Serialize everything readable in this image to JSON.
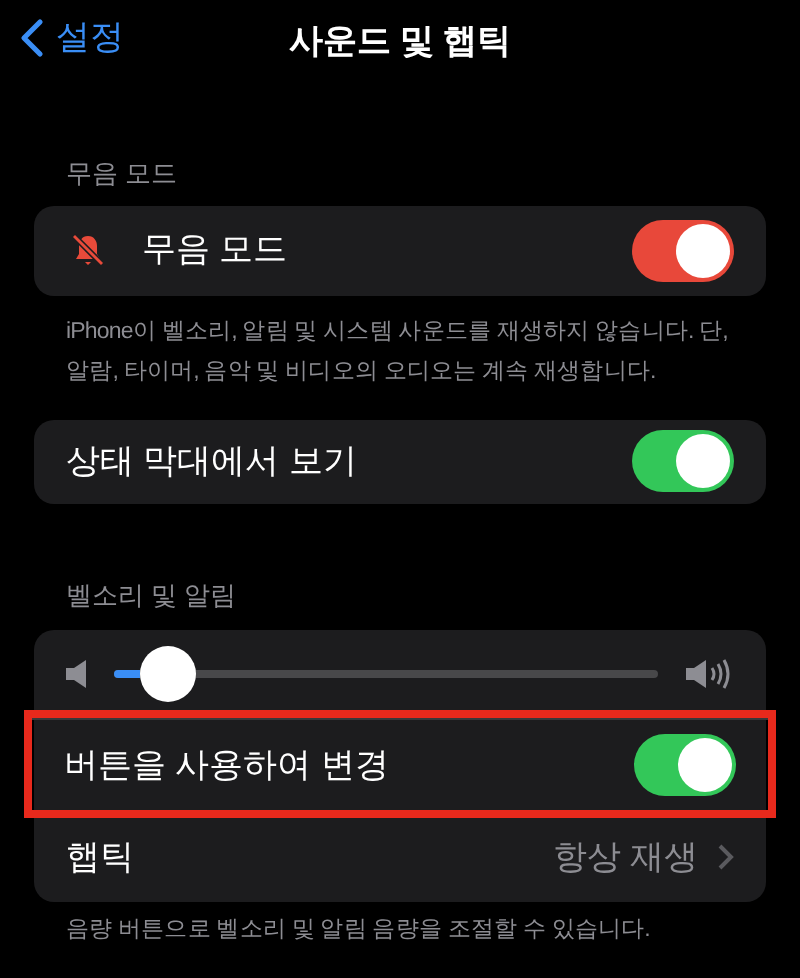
{
  "nav": {
    "back": "설정",
    "title": "사운드 및 햅틱"
  },
  "silent_section": {
    "header": "무음 모드",
    "row": {
      "label": "무음 모드",
      "on": true
    },
    "footer": "iPhone이 벨소리, 알림 및 시스템 사운드를 재생하지 않습니다. 단, 알람, 타이머, 음악 및 비디오의 오디오는 계속 재생합니다."
  },
  "status_bar_row": {
    "label": "상태 막대에서 보기",
    "on": true
  },
  "ringer_section": {
    "header": "벨소리 및 알림",
    "volume": {
      "level": 0.1
    },
    "rows": [
      {
        "kind": "toggle",
        "label": "버튼을 사용하여 변경",
        "on": true,
        "highlighted": true
      },
      {
        "kind": "link",
        "label": "햅틱",
        "value": "항상 재생",
        "highlighted": false
      }
    ],
    "footer": "음량 버튼으로 벨소리 및 알림 음량을 조절할 수 있습니다."
  }
}
